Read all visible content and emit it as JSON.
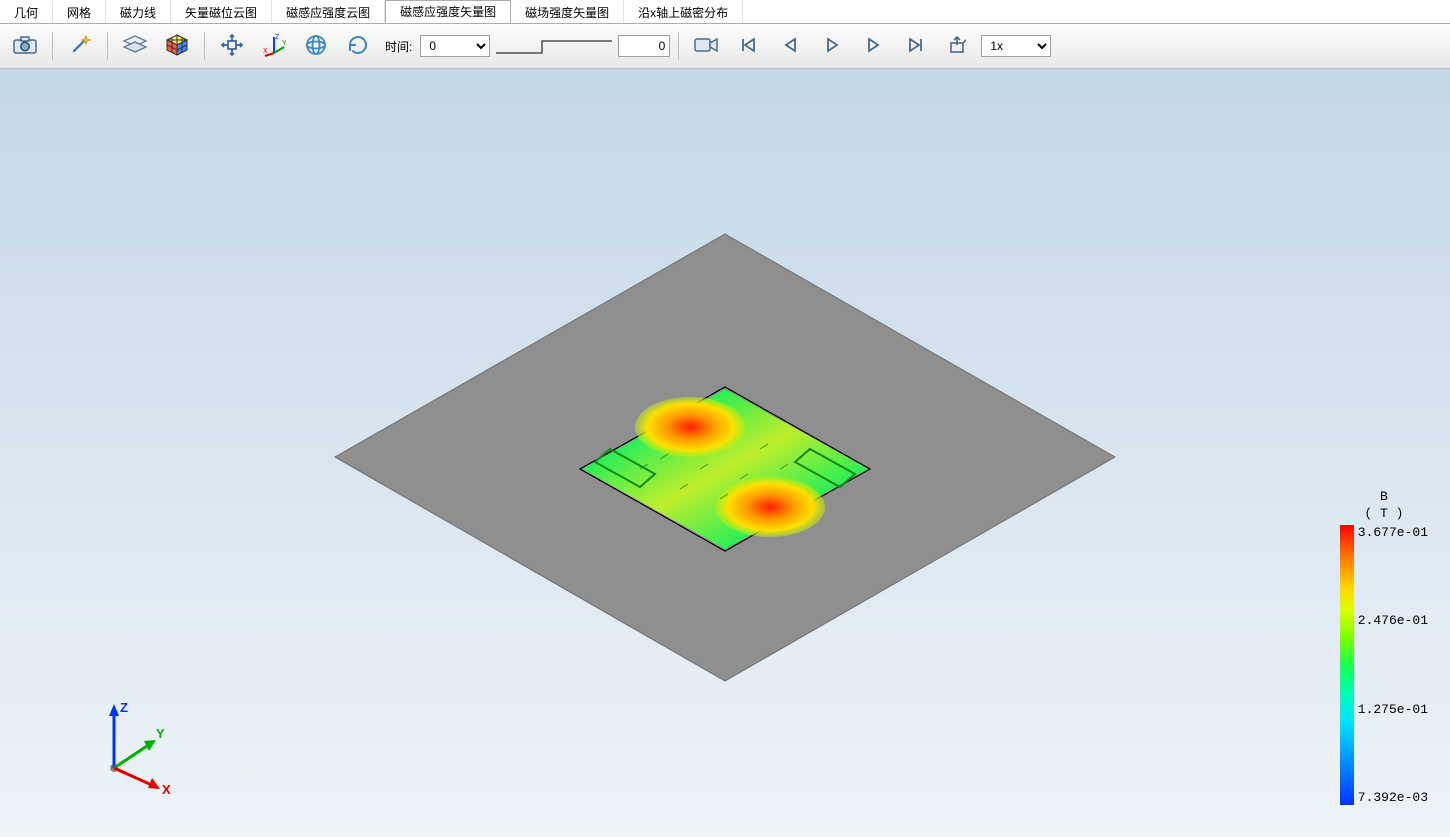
{
  "tabs": [
    {
      "label": "几何"
    },
    {
      "label": "网格"
    },
    {
      "label": "磁力线"
    },
    {
      "label": "矢量磁位云图"
    },
    {
      "label": "磁感应强度云图"
    },
    {
      "label": "磁感应强度矢量图",
      "active": true
    },
    {
      "label": "磁场强度矢量图"
    },
    {
      "label": "沿x轴上磁密分布"
    }
  ],
  "toolbar": {
    "time_label": "时间:",
    "time_from": "0",
    "time_to": "0",
    "speed": "1x",
    "icons": {
      "camera": "camera-icon",
      "wand": "magic-wand-icon",
      "layers": "layers-icon",
      "cube": "rubik-cube-icon",
      "move": "move-arrows-icon",
      "axes": "xyz-axes-icon",
      "rotate_gyro": "rotate-gyro-icon",
      "rotate_reset": "rotate-reset-icon",
      "video": "video-camera-icon",
      "first": "skip-first-icon",
      "prev": "step-prev-icon",
      "play": "play-icon",
      "next": "step-next-icon",
      "last": "skip-last-icon",
      "export": "export-icon"
    }
  },
  "triad": {
    "x": "X",
    "y": "Y",
    "z": "Z"
  },
  "legend": {
    "quantity": "B",
    "unit": "( T )",
    "ticks": [
      "3.677e-01",
      "2.476e-01",
      "1.275e-01",
      "7.392e-03"
    ]
  },
  "chart_data": {
    "type": "vector-field-3d",
    "title": "磁感应强度矢量图",
    "quantity": "B",
    "unit": "T",
    "colorbar_range": [
      0.007392,
      0.3677
    ],
    "colorbar_ticks": [
      0.007392,
      0.1275,
      0.2476,
      0.3677
    ],
    "time": 0,
    "description": "Isometric view of a flat rectangular gray plate with a smaller rectangular region at center containing a colored vector/arrow field. Two small tab-like protrusions appear on the left and right edges of the inner rectangle. Field magnitude peaks (red/orange ≈ 0.37 T) near the top-left and bottom-right ends of the inner rectangle; mid values (green/yellow ≈ 0.12–0.25 T) dominate the interior; low values (cyan/blue ≈ 0.007–0.05 T) near the short sides.",
    "approx_field_samples": [
      {
        "region": "inner_top_left_corner",
        "B_T": 0.35
      },
      {
        "region": "inner_bottom_right_corner",
        "B_T": 0.35
      },
      {
        "region": "inner_center",
        "B_T": 0.18
      },
      {
        "region": "left_tab_edge",
        "B_T": 0.12
      },
      {
        "region": "right_tab_edge",
        "B_T": 0.12
      },
      {
        "region": "inner_top_right_corner",
        "B_T": 0.05
      },
      {
        "region": "inner_bottom_left_corner",
        "B_T": 0.05
      }
    ]
  }
}
